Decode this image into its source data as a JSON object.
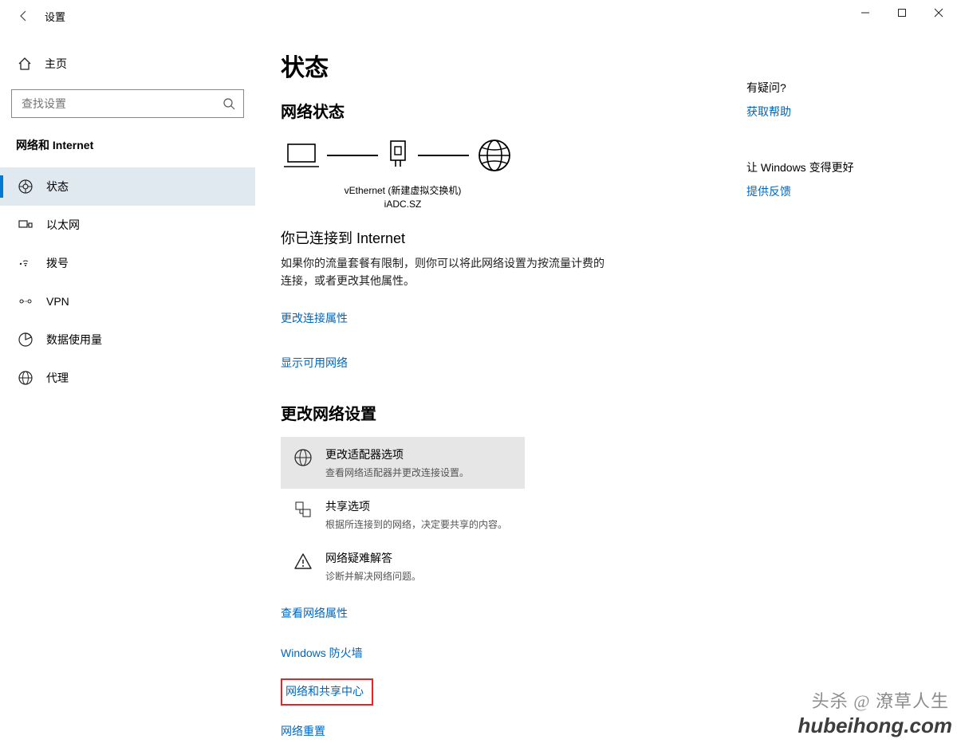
{
  "window": {
    "title": "设置"
  },
  "sidebar": {
    "home": "主页",
    "search_placeholder": "查找设置",
    "section": "网络和 Internet",
    "items": [
      {
        "label": "状态",
        "active": true
      },
      {
        "label": "以太网",
        "active": false
      },
      {
        "label": "拨号",
        "active": false
      },
      {
        "label": "VPN",
        "active": false
      },
      {
        "label": "数据使用量",
        "active": false
      },
      {
        "label": "代理",
        "active": false
      }
    ]
  },
  "page": {
    "title": "状态",
    "network_status_heading": "网络状态",
    "adapter_name": "vEthernet (新建虚拟交换机)",
    "adapter_sub": "iADC.SZ",
    "connected_heading": "你已连接到 Internet",
    "connected_desc": "如果你的流量套餐有限制，则你可以将此网络设置为按流量计费的连接，或者更改其他属性。",
    "change_props_link": "更改连接属性",
    "show_networks_link": "显示可用网络",
    "change_settings_heading": "更改网络设置",
    "tiles": [
      {
        "title": "更改适配器选项",
        "desc": "查看网络适配器并更改连接设置。",
        "hover": true
      },
      {
        "title": "共享选项",
        "desc": "根据所连接到的网络，决定要共享的内容。",
        "hover": false
      },
      {
        "title": "网络疑难解答",
        "desc": "诊断并解决网络问题。",
        "hover": false
      }
    ],
    "footer_links": [
      "查看网络属性",
      "Windows 防火墙",
      "网络和共享中心",
      "网络重置"
    ],
    "boxed_link_index": 2
  },
  "help": {
    "question": "有疑问?",
    "get_help": "获取帮助",
    "better": "让 Windows 变得更好",
    "feedback": "提供反馈"
  },
  "watermark": {
    "top": "头杀 @ 潦草人生",
    "bottom": "hubeihong.com"
  }
}
